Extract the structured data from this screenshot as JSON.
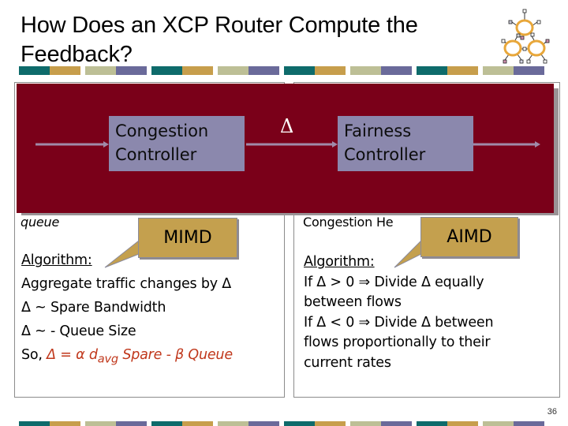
{
  "slide": {
    "title": "How Does an XCP Router Compute the Feedback?",
    "title_lines": [
      "How Does an XCP Router Compute the",
      "Feedback?"
    ],
    "page_number": "36",
    "logo": "network-rings-icon"
  },
  "colors": {
    "teal": "#0e6b6b",
    "gold": "#c79e4c",
    "sage": "#bdbf96",
    "purple": "#6a6a9a",
    "panel_red": "#7a0019",
    "controller_fill": "#8b88ad",
    "callout_fill": "#c4a04e",
    "formula_red": "#c0371b"
  },
  "diagram": {
    "congestion_controller": [
      "Congestion",
      "Controller"
    ],
    "fairness_controller": [
      "Fairness",
      "Controller"
    ],
    "delta_symbol": "Δ"
  },
  "left_box": {
    "partial_line": "queue",
    "callout": "MIMD",
    "heading": "Algorithm:",
    "lines": [
      "Aggregate traffic changes by Δ",
      "Δ ~ Spare Bandwidth",
      "Δ ~ - Queue Size"
    ],
    "formula_prefix": "So, ",
    "formula_parts": {
      "lhs": "Δ = α d",
      "sub": "avg",
      "rhs": " Spare - β Queue"
    }
  },
  "right_box": {
    "partial_line": "Congestion He",
    "callout": "AIMD",
    "heading": "Algorithm:",
    "lines": [
      "If Δ > 0 ⇒ Divide Δ equally",
      "between flows",
      "If Δ < 0 ⇒ Divide Δ between",
      "flows proportionally to their",
      "current rates"
    ]
  }
}
